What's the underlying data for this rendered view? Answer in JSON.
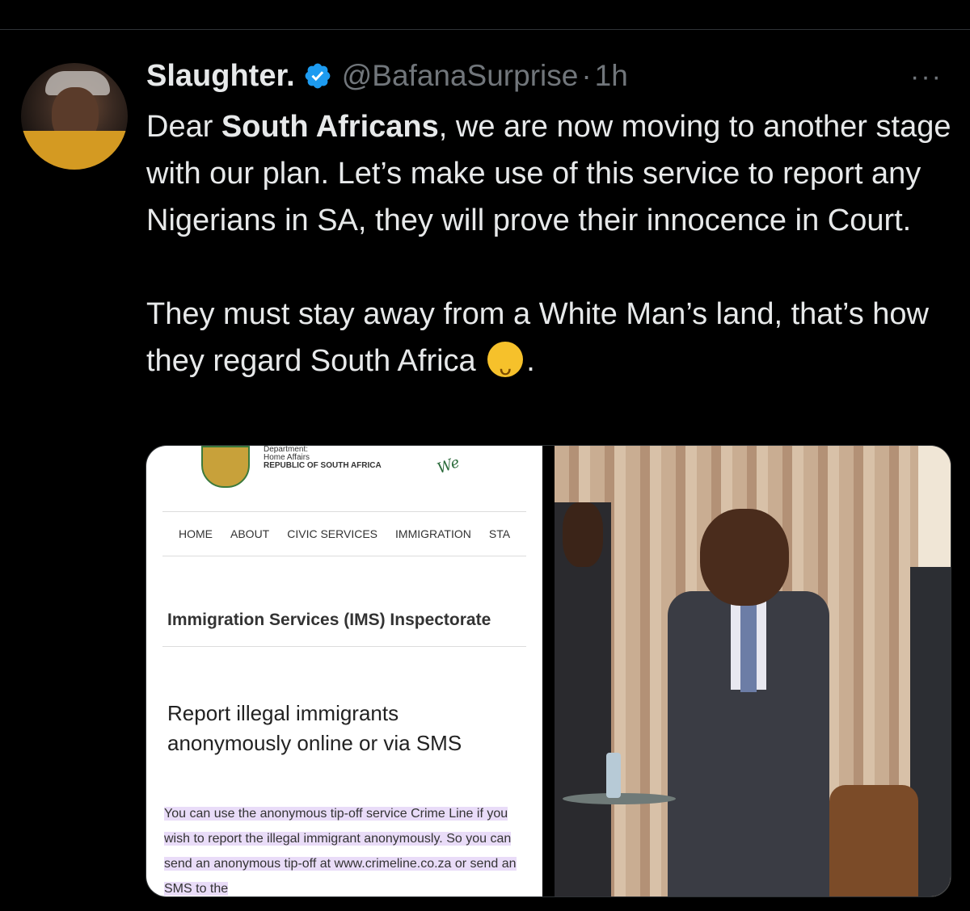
{
  "tweet": {
    "author_name": "Slaughter.",
    "handle": "@BafanaSurprise",
    "separator": "·",
    "time": "1h",
    "more_label": "···",
    "text_lines_p1": [
      "Dear ",
      "South Africans",
      ", we are now moving to another stage with our plan. Let’s make use of this service to report any Nigerians in SA, they will prove their innocence in Court."
    ],
    "text_p2_before_emoji": "They must stay away from a White Man’s land, that’s how they regard South Africa ",
    "text_p2_after_emoji": ".",
    "emoji_name": "rolling-on-the-floor-laughing-emoji"
  },
  "screenshot": {
    "dept_line1": "Department:",
    "dept_line2": "Home Affairs",
    "dept_line3": "REPUBLIC OF SOUTH AFRICA",
    "we_text": "We",
    "nav": [
      "HOME",
      "ABOUT",
      "CIVIC SERVICES",
      "IMMIGRATION",
      "STA"
    ],
    "section_title": "Immigration Services (IMS) Inspectorate",
    "heading": "Report illegal immigrants anonymously online or via SMS",
    "body": "You can use the anonymous tip-off service Crime Line if you wish to report the illegal immigrant anonymously. So you can send an anonymous tip-off at www.crimeline.co.za or send an SMS to the"
  },
  "colors": {
    "background": "#000000",
    "text": "#e7e9ea",
    "secondary": "#71767b",
    "verified": "#1d9bf0",
    "highlight": "#e9dcf8"
  }
}
